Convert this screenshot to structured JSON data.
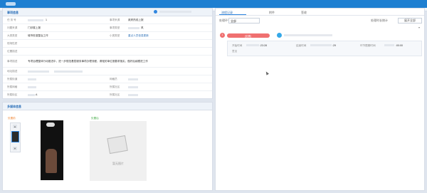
{
  "left": {
    "title": "事项信息",
    "fields": [
      {
        "label": "任 务 号",
        "value": "1",
        "label2": "事项来源",
        "value2": "政府热线上报"
      },
      {
        "label": "问题来源",
        "value": "门诊楼上报",
        "label2": "事项类型",
        "value2": "风"
      },
      {
        "label": "大类类型",
        "value": "城市校准整治工作",
        "label2": "小类类型",
        "value2": "重点人员信息更新",
        "value2_link": true
      },
      {
        "label": "现场性质",
        "value": "",
        "label2": "",
        "value2": ""
      },
      {
        "label": "位置描述",
        "value": "",
        "label2": "",
        "value2": ""
      },
      {
        "label": "事项描述",
        "value": "专项治理整体行动推进中，进一步规范基层服务事项办理流程，请相关单位按要求落实，做好后续跟进工作"
      },
      {
        "label": "地址描述",
        "value": "",
        "label2": "",
        "value2": ""
      },
      {
        "label": "所属街道",
        "value": "",
        "label2": "网格员",
        "value2": ""
      },
      {
        "label": "所属网格",
        "value": "",
        "label2": "所属社区",
        "value2": ""
      },
      {
        "label": "所属街区",
        "value": "A",
        "label2": "所属社区",
        "value2": ""
      }
    ]
  },
  "attachments": {
    "title": "多媒体信息",
    "before_label": "处置前",
    "after_label": "处置后",
    "no_image_caption": "暂无图片"
  },
  "right": {
    "tabs": [
      "流程记录",
      "附件",
      "签收"
    ],
    "filter_label": "处理环节",
    "filter_value": "全部",
    "extra_label": "处理时长统计",
    "btn_label": "展开全部",
    "entry": {
      "num": "1",
      "status": "(处置)",
      "start_label": "开始时间",
      "start_value": ":23:28",
      "end_label": "结束时间",
      "end_value": ":29",
      "deadline_label": "环节限期时间",
      "deadline_value": ":00:00",
      "note_label": "意见"
    }
  },
  "colors": {
    "primary": "#2f86e0",
    "accent": "#f07070",
    "panel_head": "#eef3f9"
  }
}
